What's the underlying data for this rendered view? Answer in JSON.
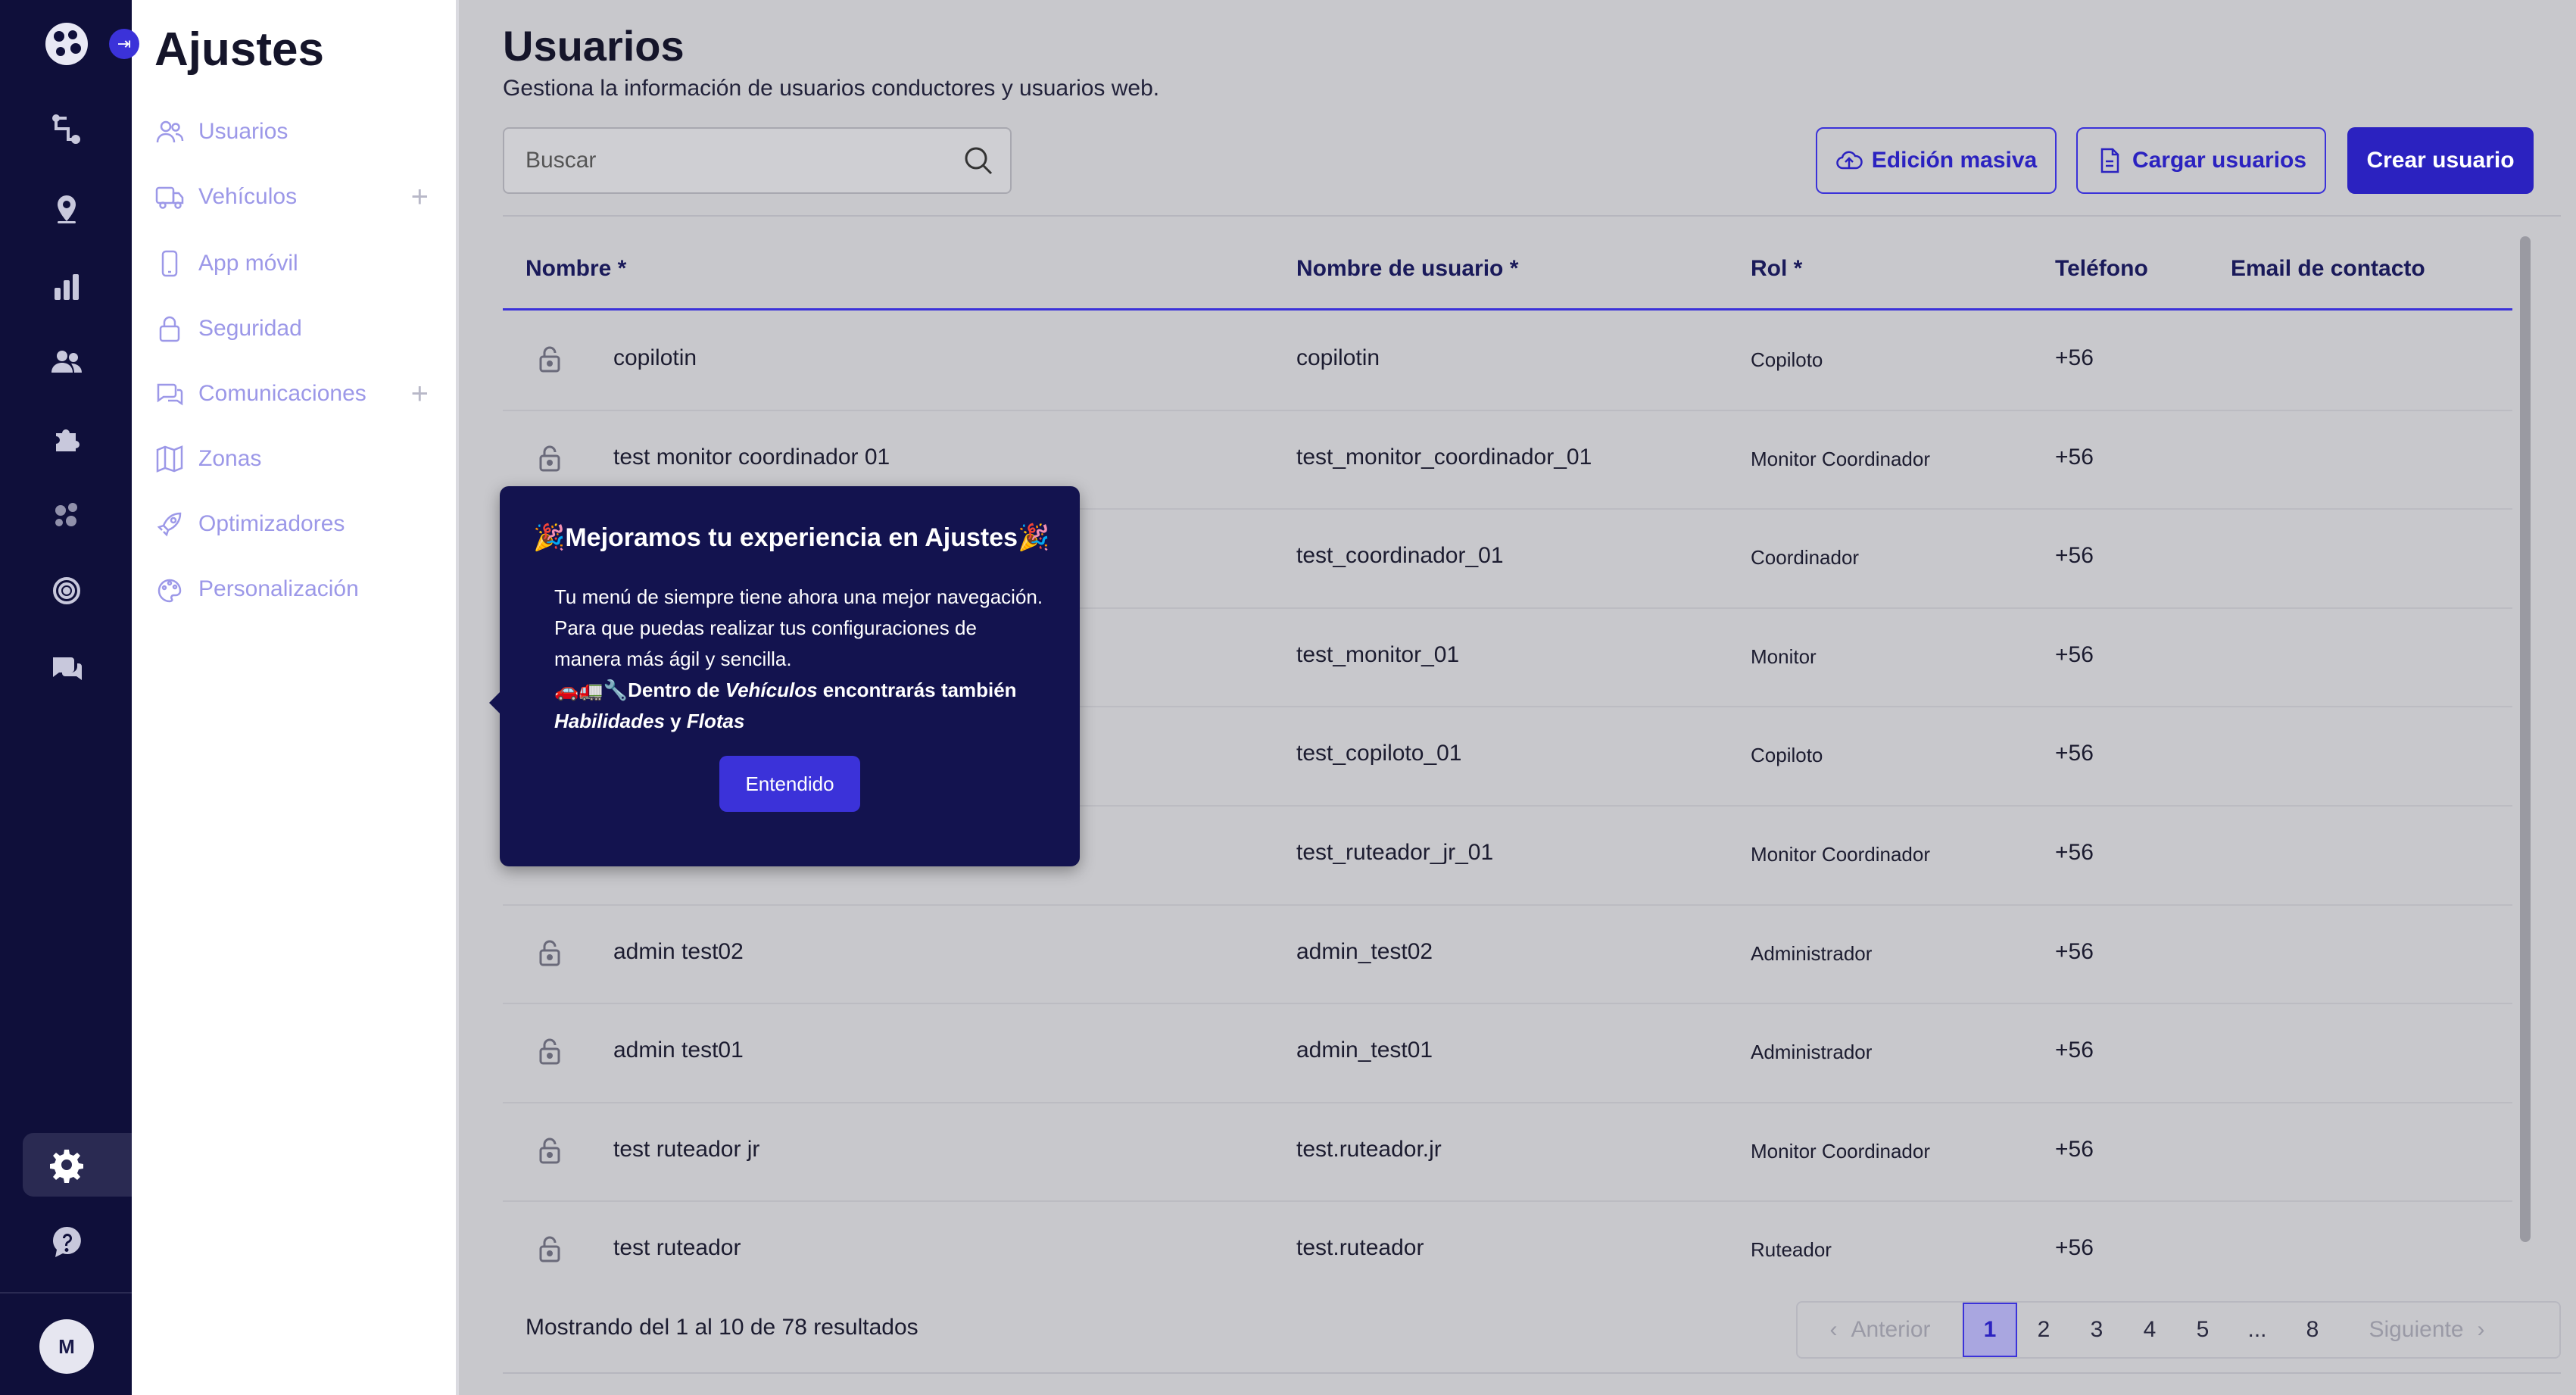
{
  "rail": {
    "expand_glyph": "⇥",
    "avatar_initial": "M",
    "icons": [
      "route-icon",
      "map-pin-icon",
      "bar-chart-icon",
      "users-icon",
      "puzzle-icon",
      "dots-icon",
      "radar-icon",
      "chat-icon",
      "gear-icon",
      "help-icon"
    ]
  },
  "submenu": {
    "title": "Ajustes",
    "items": [
      {
        "label": "Usuarios",
        "icon": "users-icon",
        "plus": ""
      },
      {
        "label": "Vehículos",
        "icon": "truck-icon",
        "plus": "+"
      },
      {
        "label": "App móvil",
        "icon": "phone-icon",
        "plus": ""
      },
      {
        "label": "Seguridad",
        "icon": "lock-icon",
        "plus": ""
      },
      {
        "label": "Comunicaciones",
        "icon": "chat-icon",
        "plus": "+"
      },
      {
        "label": "Zonas",
        "icon": "map-icon",
        "plus": ""
      },
      {
        "label": "Optimizadores",
        "icon": "rocket-icon",
        "plus": ""
      },
      {
        "label": "Personalización",
        "icon": "palette-icon",
        "plus": ""
      }
    ]
  },
  "main": {
    "title": "Usuarios",
    "subtitle": "Gestiona la información de usuarios conductores y usuarios web.",
    "search_placeholder": "Buscar",
    "buttons": {
      "bulk_edit": "Edición masiva",
      "upload_users": "Cargar usuarios",
      "create_user": "Crear usuario"
    },
    "columns": [
      "Nombre *",
      "Nombre de usuario *",
      "Rol *",
      "Teléfono",
      "Email de contacto"
    ],
    "rows": [
      {
        "name": "copilotin",
        "username": "copilotin",
        "role": "Copiloto",
        "phone": "+56"
      },
      {
        "name": "test monitor coordinador 01",
        "username": "test_monitor_coordinador_01",
        "role": "Monitor Coordinador",
        "phone": "+56"
      },
      {
        "name": "",
        "username": "test_coordinador_01",
        "role": "Coordinador",
        "phone": "+56"
      },
      {
        "name": "",
        "username": "test_monitor_01",
        "role": "Monitor",
        "phone": "+56"
      },
      {
        "name": "",
        "username": "test_copiloto_01",
        "role": "Copiloto",
        "phone": "+56"
      },
      {
        "name": "",
        "username": "test_ruteador_jr_01",
        "role": "Monitor Coordinador",
        "phone": "+56"
      },
      {
        "name": "admin test02",
        "username": "admin_test02",
        "role": "Administrador",
        "phone": "+56"
      },
      {
        "name": "admin test01",
        "username": "admin_test01",
        "role": "Administrador",
        "phone": "+56"
      },
      {
        "name": "test ruteador jr",
        "username": "test.ruteador.jr",
        "role": "Monitor Coordinador",
        "phone": "+56"
      },
      {
        "name": "test ruteador",
        "username": "test.ruteador",
        "role": "Ruteador",
        "phone": "+56"
      }
    ],
    "showing": "Mostrando del 1 al 10 de 78 resultados",
    "pagination": {
      "prev": "Anterior",
      "next": "Siguiente",
      "pages": [
        "1",
        "2",
        "3",
        "4",
        "5",
        "...",
        "8"
      ],
      "current": "1"
    }
  },
  "popover": {
    "title": "🎉Mejoramos tu experiencia en Ajustes🎉",
    "body_line1": "Tu menú de siempre tiene ahora una mejor navegación. Para que puedas realizar tus configuraciones de manera más ágil y sencilla.",
    "emoji": "🚗🚛🔧",
    "bold_a": "Dentro de ",
    "italic_a": "Vehículos",
    "bold_b": " encontrarás también ",
    "italic_b": "Habilidades",
    "bold_c": " y ",
    "italic_c": "Flotas",
    "button": "Entendido"
  },
  "colors": {
    "rail_bg": "#0f0f3a",
    "accent": "#2b22c0",
    "submenu_text": "#9c98e8",
    "popover_bg": "#13134f"
  }
}
